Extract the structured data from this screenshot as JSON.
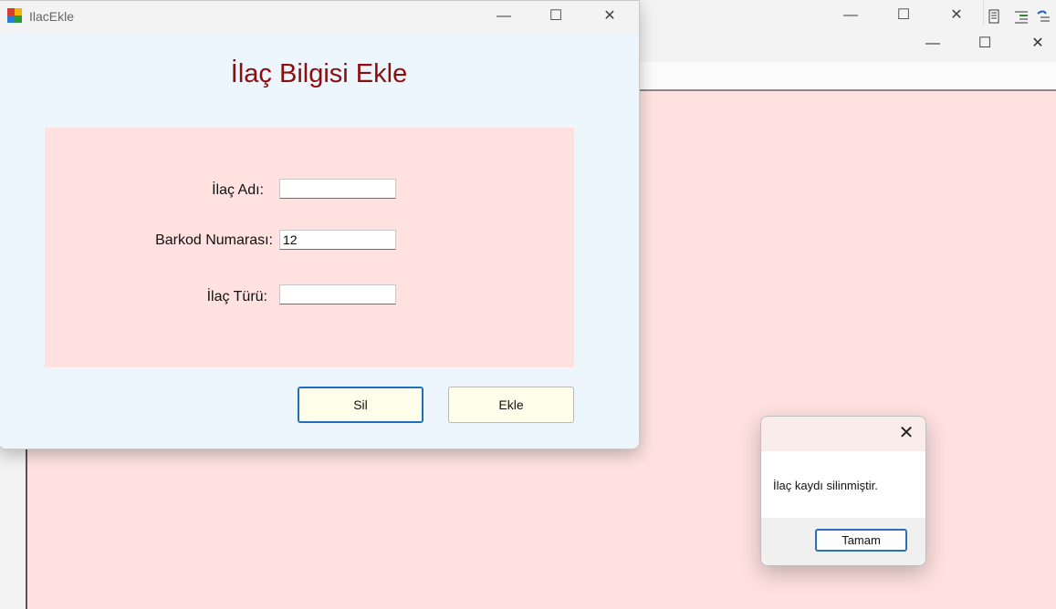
{
  "background_window": {
    "minimize_glyph": "—",
    "maximize_glyph": "☐",
    "close_glyph": "✕"
  },
  "main_window": {
    "minimize_glyph": "—",
    "maximize_glyph": "☐",
    "close_glyph": "✕",
    "client_color": "#ffe2e0"
  },
  "ilac_window": {
    "title": "IlacEkle",
    "minimize_glyph": "—",
    "maximize_glyph": "☐",
    "close_glyph": "✕",
    "heading": "İlaç Bilgisi Ekle",
    "heading_color": "#8b0d0d",
    "form": {
      "name_label": "İlaç Adı:",
      "name_value": "",
      "barcode_label": "Barkod Numarası:",
      "barcode_value": "12",
      "type_label": "İlaç Türü:",
      "type_value": ""
    },
    "buttons": {
      "delete_label": "Sil",
      "add_label": "Ekle"
    }
  },
  "message_box": {
    "close_glyph": "✕",
    "message": "İlaç kaydı silinmiştir.",
    "ok_label": "Tamam"
  },
  "icons": [
    "app-icon",
    "minimize-icon",
    "maximize-icon",
    "close-icon",
    "toolbar-icons"
  ]
}
